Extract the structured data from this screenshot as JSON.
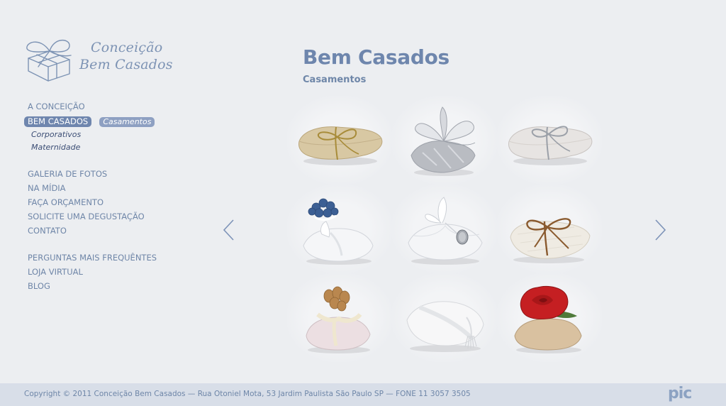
{
  "brand": {
    "line1": "Conceição",
    "line2": "Bem Casados"
  },
  "nav": {
    "items_top": [
      {
        "label": "A CONCEIÇÃO"
      },
      {
        "label": "BEM CASADOS",
        "active": true
      }
    ],
    "sub_items": [
      {
        "label": "Casamentos",
        "active": true
      },
      {
        "label": "Corporativos"
      },
      {
        "label": "Maternidade"
      }
    ],
    "items_mid": [
      {
        "label": "GALERIA DE FOTOS"
      },
      {
        "label": "NA MÍDIA"
      },
      {
        "label": "FAÇA ORÇAMENTO"
      },
      {
        "label": "SOLICITE UMA DEGUSTAÇÃO"
      },
      {
        "label": "CONTATO"
      }
    ],
    "items_bottom": [
      {
        "label": "PERGUNTAS MAIS FREQUÊNTES"
      },
      {
        "label": "LOJA VIRTUAL"
      },
      {
        "label": "BLOG"
      }
    ]
  },
  "main": {
    "title": "Bem Casados",
    "subtitle": "Casamentos"
  },
  "gallery": {
    "products": [
      {
        "icon": "burlap-gold-ribbon-favor"
      },
      {
        "icon": "silver-organza-favor"
      },
      {
        "icon": "white-linen-silver-ribbon-favor"
      },
      {
        "icon": "white-favor-blue-flowers"
      },
      {
        "icon": "white-favor-medal"
      },
      {
        "icon": "cream-favor-brown-cord"
      },
      {
        "icon": "pink-favor-cork-flower"
      },
      {
        "icon": "white-satin-tassel-favor"
      },
      {
        "icon": "beige-favor-red-rose"
      }
    ]
  },
  "footer": {
    "copyright": "Copyright © 2011 Conceição Bem Casados  — Rua Otoniel Mota, 53 Jardim Paulista São Paulo SP — FONE 11 3057 3505",
    "credit": "pic"
  },
  "colors": {
    "accent": "#6e86ad",
    "footer_bg": "#d8dee8",
    "page_bg": "#eceef1"
  }
}
